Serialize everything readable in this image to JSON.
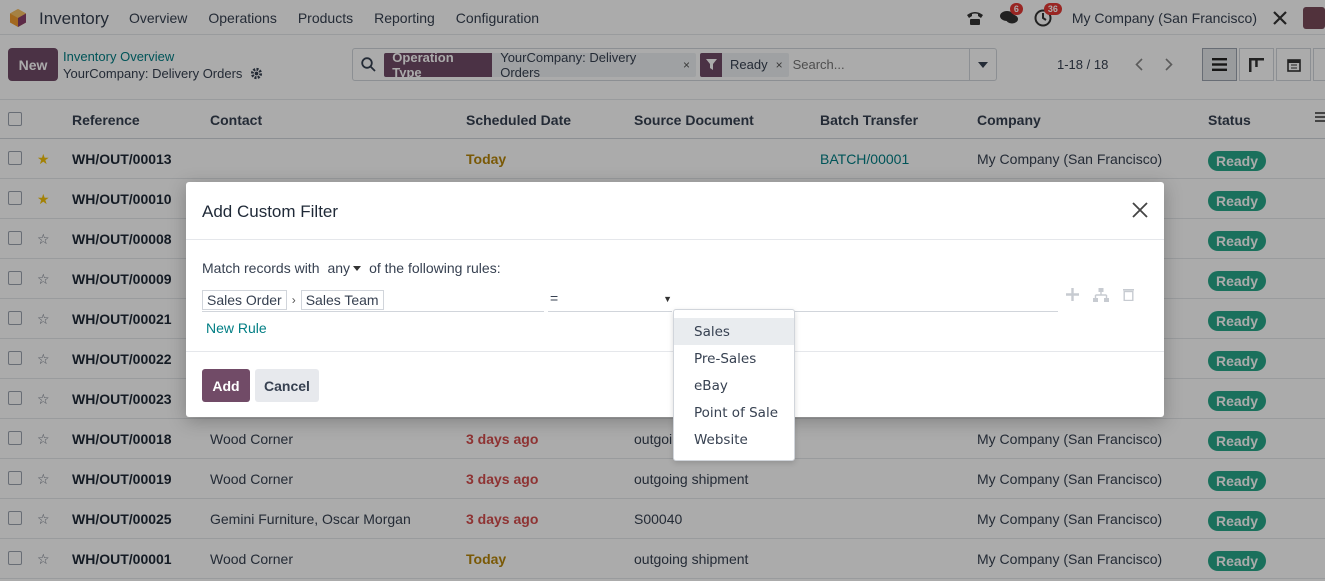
{
  "navbar": {
    "app_name": "Inventory",
    "menu": [
      "Overview",
      "Operations",
      "Products",
      "Reporting",
      "Configuration"
    ],
    "messages_count": "6",
    "activities_count": "36",
    "company": "My Company (San Francisco)"
  },
  "control": {
    "new_label": "New",
    "breadcrumb_parent": "Inventory Overview",
    "breadcrumb_current": "YourCompany: Delivery Orders",
    "facets": [
      {
        "label": "Operation Type",
        "value": "YourCompany: Delivery Orders"
      },
      {
        "label": "",
        "value": "Ready"
      }
    ],
    "search_placeholder": "Search...",
    "pager": "1-18 / 18"
  },
  "table": {
    "headers": [
      "Reference",
      "Contact",
      "Scheduled Date",
      "Source Document",
      "Batch Transfer",
      "Company",
      "Status"
    ],
    "rows": [
      {
        "ref": "WH/OUT/00013",
        "contact": "",
        "sched": "Today",
        "sched_kind": "warn",
        "src": "",
        "batch": "BATCH/00001",
        "company": "My Company (San Francisco)",
        "status": "Ready",
        "fav": true
      },
      {
        "ref": "WH/OUT/00010",
        "contact": "",
        "sched": "",
        "sched_kind": "",
        "src": "",
        "batch": "",
        "company": "",
        "status": "Ready",
        "fav": true
      },
      {
        "ref": "WH/OUT/00008",
        "contact": "",
        "sched": "",
        "sched_kind": "",
        "src": "",
        "batch": "",
        "company": "",
        "status": "Ready",
        "fav": false
      },
      {
        "ref": "WH/OUT/00009",
        "contact": "",
        "sched": "",
        "sched_kind": "",
        "src": "",
        "batch": "",
        "company": "",
        "status": "Ready",
        "fav": false
      },
      {
        "ref": "WH/OUT/00021",
        "contact": "",
        "sched": "",
        "sched_kind": "",
        "src": "",
        "batch": "",
        "company": "",
        "status": "Ready",
        "fav": false
      },
      {
        "ref": "WH/OUT/00022",
        "contact": "",
        "sched": "",
        "sched_kind": "",
        "src": "",
        "batch": "",
        "company": "",
        "status": "Ready",
        "fav": false
      },
      {
        "ref": "WH/OUT/00023",
        "contact": "",
        "sched": "",
        "sched_kind": "",
        "src": "",
        "batch": "",
        "company": "",
        "status": "Ready",
        "fav": false
      },
      {
        "ref": "WH/OUT/00018",
        "contact": "Wood Corner",
        "sched": "3 days ago",
        "sched_kind": "late",
        "src": "outgoi",
        "batch": "",
        "company": "My Company (San Francisco)",
        "status": "Ready",
        "fav": false
      },
      {
        "ref": "WH/OUT/00019",
        "contact": "Wood Corner",
        "sched": "3 days ago",
        "sched_kind": "late",
        "src": "outgoing shipment",
        "batch": "",
        "company": "My Company (San Francisco)",
        "status": "Ready",
        "fav": false
      },
      {
        "ref": "WH/OUT/00025",
        "contact": "Gemini Furniture, Oscar Morgan",
        "sched": "3 days ago",
        "sched_kind": "late",
        "src": "S00040",
        "batch": "",
        "company": "My Company (San Francisco)",
        "status": "Ready",
        "fav": false
      },
      {
        "ref": "WH/OUT/00001",
        "contact": "Wood Corner",
        "sched": "Today",
        "sched_kind": "warn",
        "src": "outgoing shipment",
        "batch": "",
        "company": "My Company (San Francisco)",
        "status": "Ready",
        "fav": false
      }
    ]
  },
  "modal": {
    "title": "Add Custom Filter",
    "match_prefix": "Match records with",
    "match_mode": "any",
    "match_suffix": "of the following rules:",
    "path": [
      "Sales Order",
      "Sales Team"
    ],
    "operator": "=",
    "new_rule": "New Rule",
    "add_label": "Add",
    "cancel_label": "Cancel"
  },
  "dropdown": {
    "options": [
      "Sales",
      "Pre-Sales",
      "eBay",
      "Point of Sale",
      "Website"
    ],
    "highlighted": "Sales"
  }
}
